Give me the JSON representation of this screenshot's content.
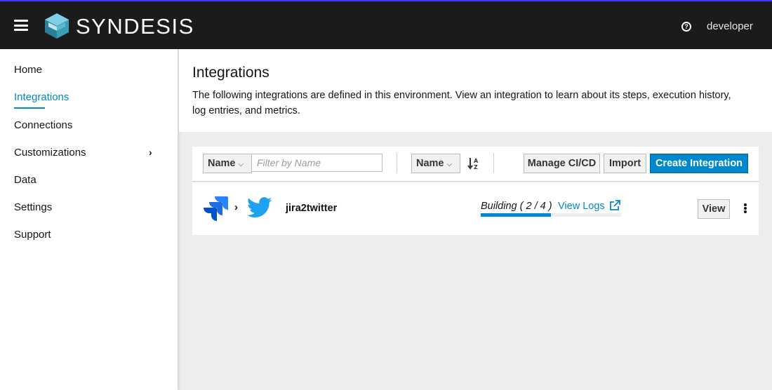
{
  "app": {
    "name": "SYNDESIS",
    "user": "developer",
    "help_glyph": "?"
  },
  "nav": {
    "items": [
      {
        "label": "Home",
        "active": false
      },
      {
        "label": "Integrations",
        "active": true
      },
      {
        "label": "Connections",
        "active": false
      },
      {
        "label": "Customizations",
        "active": false,
        "has_submenu": true
      },
      {
        "label": "Data",
        "active": false
      },
      {
        "label": "Settings",
        "active": false
      },
      {
        "label": "Support",
        "active": false
      }
    ],
    "chevron_glyph": "›"
  },
  "page": {
    "title": "Integrations",
    "description": "The following integrations are defined in this environment. View an integration to learn about its steps, execution history, log entries, and metrics."
  },
  "toolbar": {
    "filter_type_label": "Name",
    "filter_placeholder": "Filter by Name",
    "sort_field_label": "Name",
    "caret_glyph": "⌵",
    "manage_cicd_label": "Manage CI/CD",
    "import_label": "Import",
    "create_label": "Create Integration"
  },
  "integrations": [
    {
      "name": "jira2twitter",
      "from_icon": "jira-icon",
      "to_icon": "twitter-icon",
      "arrow_glyph": "›",
      "status": "Building ( 2 / 4 )",
      "progress": 0.5,
      "view_logs_label": "View Logs",
      "view_label": "View"
    }
  ],
  "colors": {
    "accent": "#0088ce",
    "topbar": "#1b1b1b",
    "jira": "#2684ff",
    "twitter": "#1da1f2"
  }
}
